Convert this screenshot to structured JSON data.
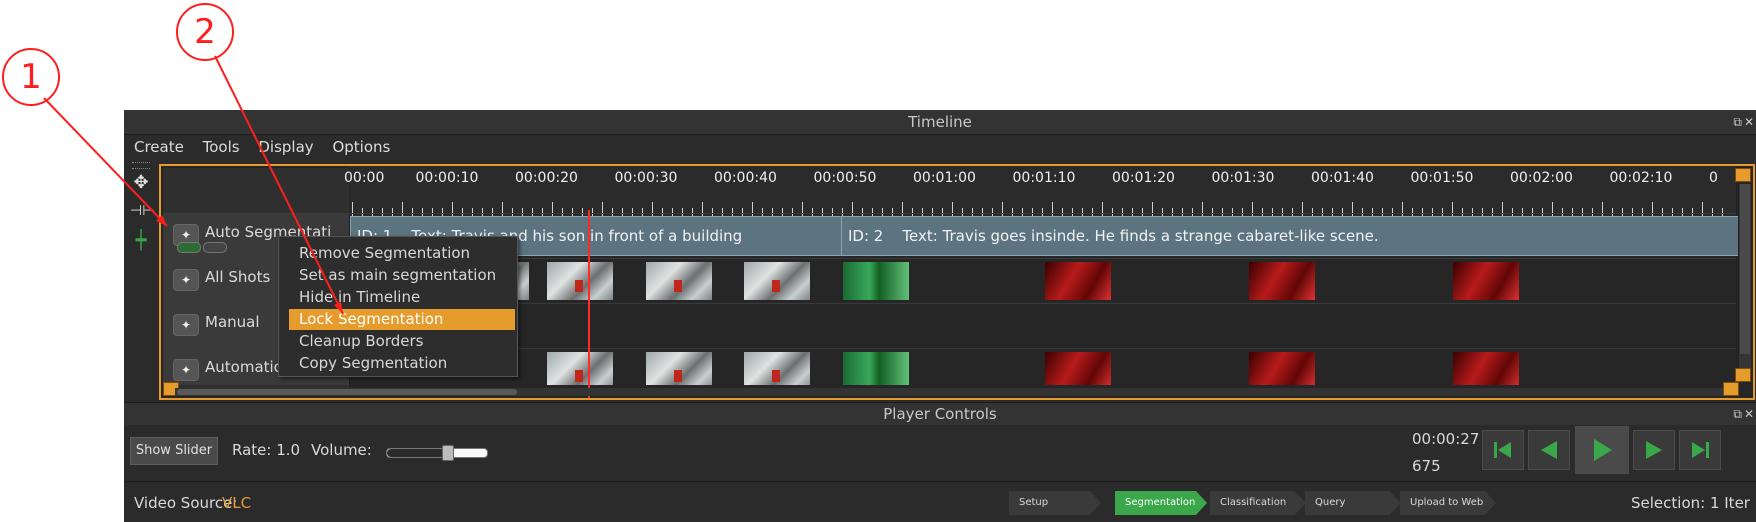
{
  "window": {
    "title": "Timeline",
    "menu": [
      "Create",
      "Tools",
      "Display",
      "Options"
    ]
  },
  "timeline": {
    "ruler_labels": [
      "00:00",
      "00:00:10",
      "00:00:20",
      "00:00:30",
      "00:00:40",
      "00:00:50",
      "00:01:00",
      "00:01:10",
      "00:01:20",
      "00:01:30",
      "00:01:40",
      "00:01:50",
      "00:02:00",
      "00:02:10",
      "0"
    ],
    "tracks": [
      {
        "name": "Auto Segmentati"
      },
      {
        "name": "All Shots"
      },
      {
        "name": "Manual"
      },
      {
        "name": "Automatio"
      }
    ],
    "segments": [
      {
        "id_label": "ID: 1",
        "text_label": "Text: Travis and his son in front of a building"
      },
      {
        "id_label": "ID: 2",
        "text_label": "Text: Travis goes insinde. He finds a strange cabaret-like scene."
      }
    ]
  },
  "context_menu": {
    "items": [
      "Remove Segmentation",
      "Set as main segmentation",
      "Hide in Timeline",
      "Lock Segmentation",
      "Cleanup Borders",
      "Copy Segmentation"
    ],
    "highlighted": "Lock Segmentation"
  },
  "player_controls": {
    "title": "Player Controls",
    "show_slider": "Show Slider",
    "rate": "Rate:  1.0",
    "volume": "Volume:",
    "volume_level": 0.58,
    "time": "00:00:27",
    "frame": "675",
    "buttons": [
      "skip-back-icon",
      "step-back-icon",
      "play-icon",
      "step-forward-icon",
      "skip-forward-icon"
    ]
  },
  "statusbar": {
    "video_source_label": "Video Source:",
    "video_source_value": "VLC",
    "steps": [
      "Setup",
      "Segmentation",
      "Classification",
      "Query",
      "Upload to Web"
    ],
    "active_step": "Segmentation",
    "selection": "Selection:  1 Iter"
  },
  "annotations": [
    "1",
    "2"
  ],
  "colors": {
    "accent": "#e59c2d",
    "active_step": "#3aa84a",
    "playhead": "#ff2b2b",
    "annotation": "#ff1e1e",
    "segment": "#5b7480"
  }
}
